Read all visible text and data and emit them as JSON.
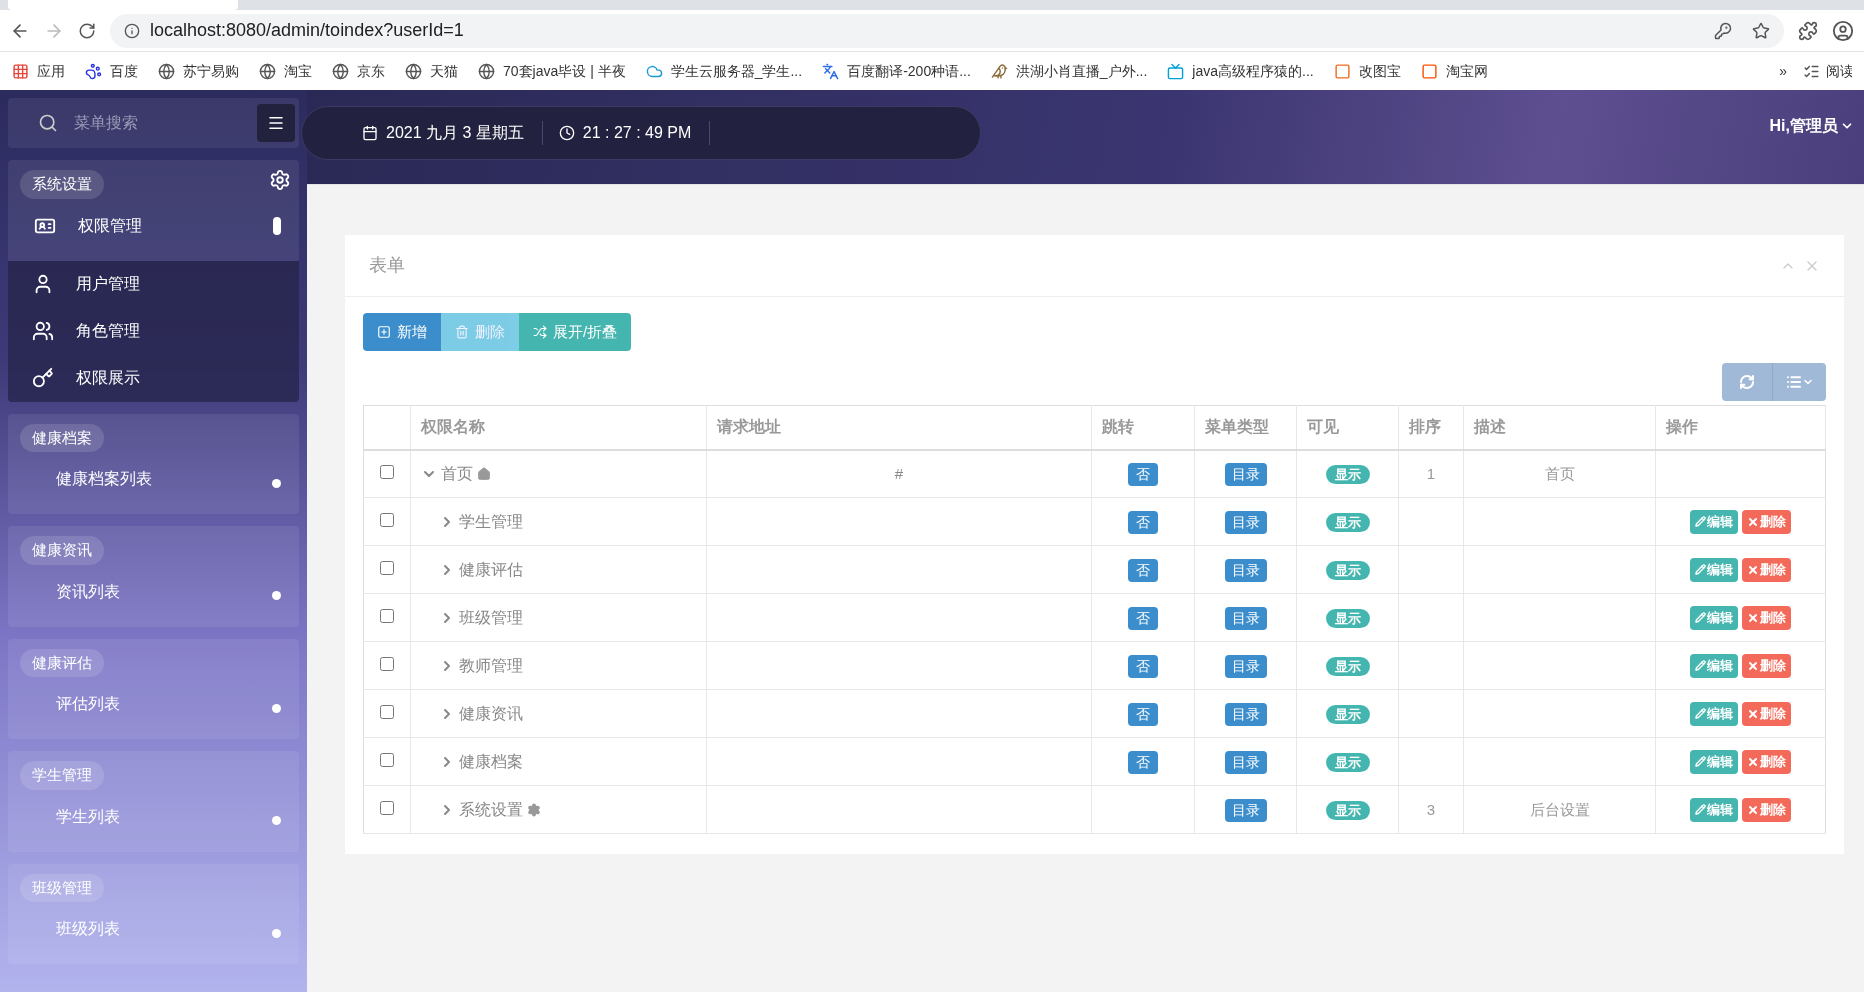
{
  "browser": {
    "url": "localhost:8080/admin/toindex?userId=1",
    "bookmarks": [
      {
        "label": "应用",
        "kind": "apps"
      },
      {
        "label": "百度",
        "kind": "paw"
      },
      {
        "label": "苏宁易购",
        "kind": "globe"
      },
      {
        "label": "淘宝",
        "kind": "globe"
      },
      {
        "label": "京东",
        "kind": "globe"
      },
      {
        "label": "天猫",
        "kind": "globe"
      },
      {
        "label": "70套java毕设 | 半夜",
        "kind": "globe"
      },
      {
        "label": "学生云服务器_学生...",
        "kind": "cloud"
      },
      {
        "label": "百度翻译-200种语...",
        "kind": "translate"
      },
      {
        "label": "洪湖小肖直播_户外...",
        "kind": "bird"
      },
      {
        "label": "java高级程序猿的...",
        "kind": "tv"
      },
      {
        "label": "改图宝",
        "kind": "square"
      },
      {
        "label": "淘宝网",
        "kind": "taobao"
      }
    ],
    "overflow": "»",
    "reading_list": "阅读"
  },
  "sidebar": {
    "search_placeholder": "菜单搜索",
    "groups": [
      {
        "title": "系统设置",
        "items": [
          {
            "label": "权限管理",
            "expanded": true,
            "children": [
              {
                "label": "用户管理",
                "kind": "user"
              },
              {
                "label": "角色管理",
                "kind": "users"
              },
              {
                "label": "权限展示",
                "kind": "key"
              }
            ]
          }
        ]
      },
      {
        "title": "健康档案",
        "items": [
          {
            "label": "健康档案列表",
            "expanded": false
          }
        ]
      },
      {
        "title": "健康资讯",
        "items": [
          {
            "label": "资讯列表",
            "expanded": false
          }
        ]
      },
      {
        "title": "健康评估",
        "items": [
          {
            "label": "评估列表",
            "expanded": false
          }
        ]
      },
      {
        "title": "学生管理",
        "items": [
          {
            "label": "学生列表",
            "expanded": false
          }
        ]
      },
      {
        "title": "班级管理",
        "items": [
          {
            "label": "班级列表",
            "expanded": false
          }
        ]
      }
    ]
  },
  "header": {
    "date": "2021 九月 3 星期五",
    "time": "21 : 27 : 49 PM",
    "user": "Hi,管理员"
  },
  "panel": {
    "title": "表单",
    "buttons": [
      {
        "label": "新增",
        "kind": "add",
        "disabled": false
      },
      {
        "label": "删除",
        "kind": "delete",
        "disabled": true
      },
      {
        "label": "展开/折叠",
        "kind": "toggle",
        "disabled": false
      }
    ],
    "table": {
      "columns": [
        "权限名称",
        "请求地址",
        "跳转",
        "菜单类型",
        "可见",
        "排序",
        "描述",
        "操作"
      ],
      "rows": [
        {
          "name": "首页",
          "kind": "home",
          "expanded": true,
          "checked": false,
          "url": "#",
          "jump": "否",
          "type": "目录",
          "visible": "显示",
          "sort": "1",
          "desc": "首页",
          "children": [
            {
              "name": "学生管理",
              "kind": "plain",
              "expanded": false,
              "checked": false,
              "jump": "否",
              "type": "目录",
              "visible": "显示",
              "actions": [
                "编辑",
                "删除"
              ]
            },
            {
              "name": "健康评估",
              "kind": "plain",
              "expanded": false,
              "checked": false,
              "jump": "否",
              "type": "目录",
              "visible": "显示",
              "actions": [
                "编辑",
                "删除"
              ]
            },
            {
              "name": "班级管理",
              "kind": "plain",
              "expanded": false,
              "checked": false,
              "jump": "否",
              "type": "目录",
              "visible": "显示",
              "actions": [
                "编辑",
                "删除"
              ]
            },
            {
              "name": "教师管理",
              "kind": "plain",
              "expanded": false,
              "checked": false,
              "jump": "否",
              "type": "目录",
              "visible": "显示",
              "actions": [
                "编辑",
                "删除"
              ]
            },
            {
              "name": "健康资讯",
              "kind": "plain",
              "expanded": false,
              "checked": false,
              "jump": "否",
              "type": "目录",
              "visible": "显示",
              "actions": [
                "编辑",
                "删除"
              ]
            },
            {
              "name": "健康档案",
              "kind": "plain",
              "expanded": false,
              "checked": false,
              "jump": "否",
              "type": "目录",
              "visible": "显示",
              "actions": [
                "编辑",
                "删除"
              ]
            },
            {
              "name": "系统设置",
              "kind": "settings",
              "expanded": false,
              "checked": false,
              "type": "目录",
              "visible": "显示",
              "sort": "3",
              "desc": "后台设置",
              "actions": [
                "编辑",
                "删除"
              ]
            }
          ]
        }
      ]
    }
  }
}
